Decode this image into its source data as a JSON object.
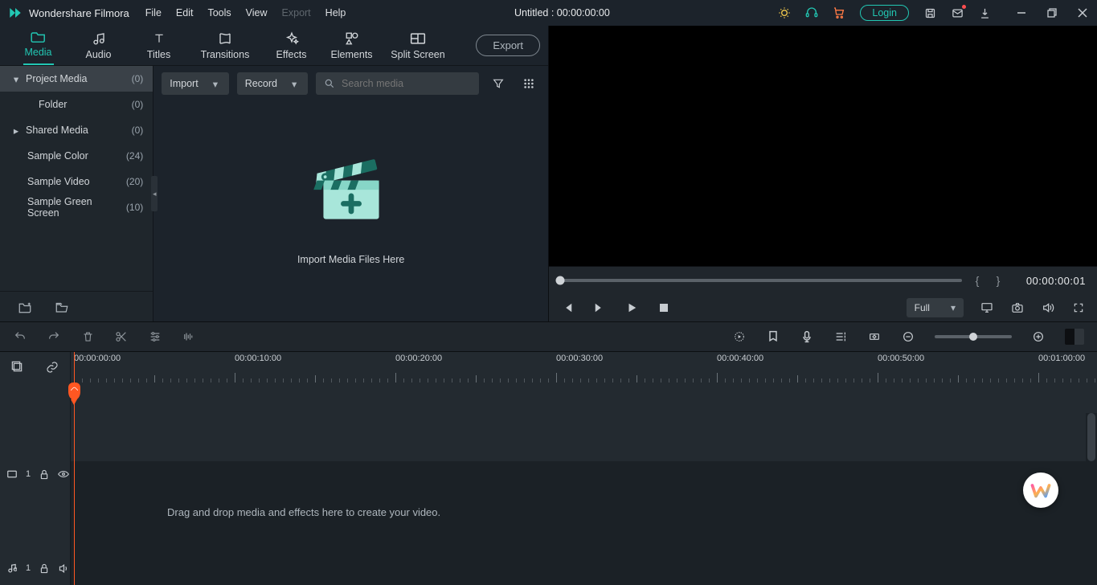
{
  "app": {
    "name": "Wondershare Filmora"
  },
  "menu": {
    "file": "File",
    "edit": "Edit",
    "tools": "Tools",
    "view": "View",
    "export": "Export",
    "help": "Help"
  },
  "title": "Untitled : 00:00:00:00",
  "login": "Login",
  "tabs": {
    "media": "Media",
    "audio": "Audio",
    "titles": "Titles",
    "transitions": "Transitions",
    "effects": "Effects",
    "elements": "Elements",
    "split": "Split Screen",
    "export_btn": "Export"
  },
  "sidebar": {
    "items": [
      {
        "label": "Project Media",
        "count": "(0)",
        "chev": "down",
        "selected": true,
        "indent": 0
      },
      {
        "label": "Folder",
        "count": "(0)",
        "chev": "",
        "indent": 2
      },
      {
        "label": "Shared Media",
        "count": "(0)",
        "chev": "right",
        "indent": 0
      },
      {
        "label": "Sample Color",
        "count": "(24)",
        "chev": "",
        "indent": 1
      },
      {
        "label": "Sample Video",
        "count": "(20)",
        "chev": "",
        "indent": 1
      },
      {
        "label": "Sample Green Screen",
        "count": "(10)",
        "chev": "",
        "indent": 1
      }
    ]
  },
  "media": {
    "import": "Import",
    "record": "Record",
    "search_placeholder": "Search media",
    "drop_hint": "Import Media Files Here"
  },
  "preview": {
    "timecode": "00:00:00:01",
    "quality": "Full"
  },
  "timeline": {
    "labels": [
      "00:00:00:00",
      "00:00:10:00",
      "00:00:20:00",
      "00:00:30:00",
      "00:00:40:00",
      "00:00:50:00",
      "00:01:00:00"
    ],
    "track_video": "1",
    "track_audio": "1",
    "hint": "Drag and drop media and effects here to create your video."
  }
}
